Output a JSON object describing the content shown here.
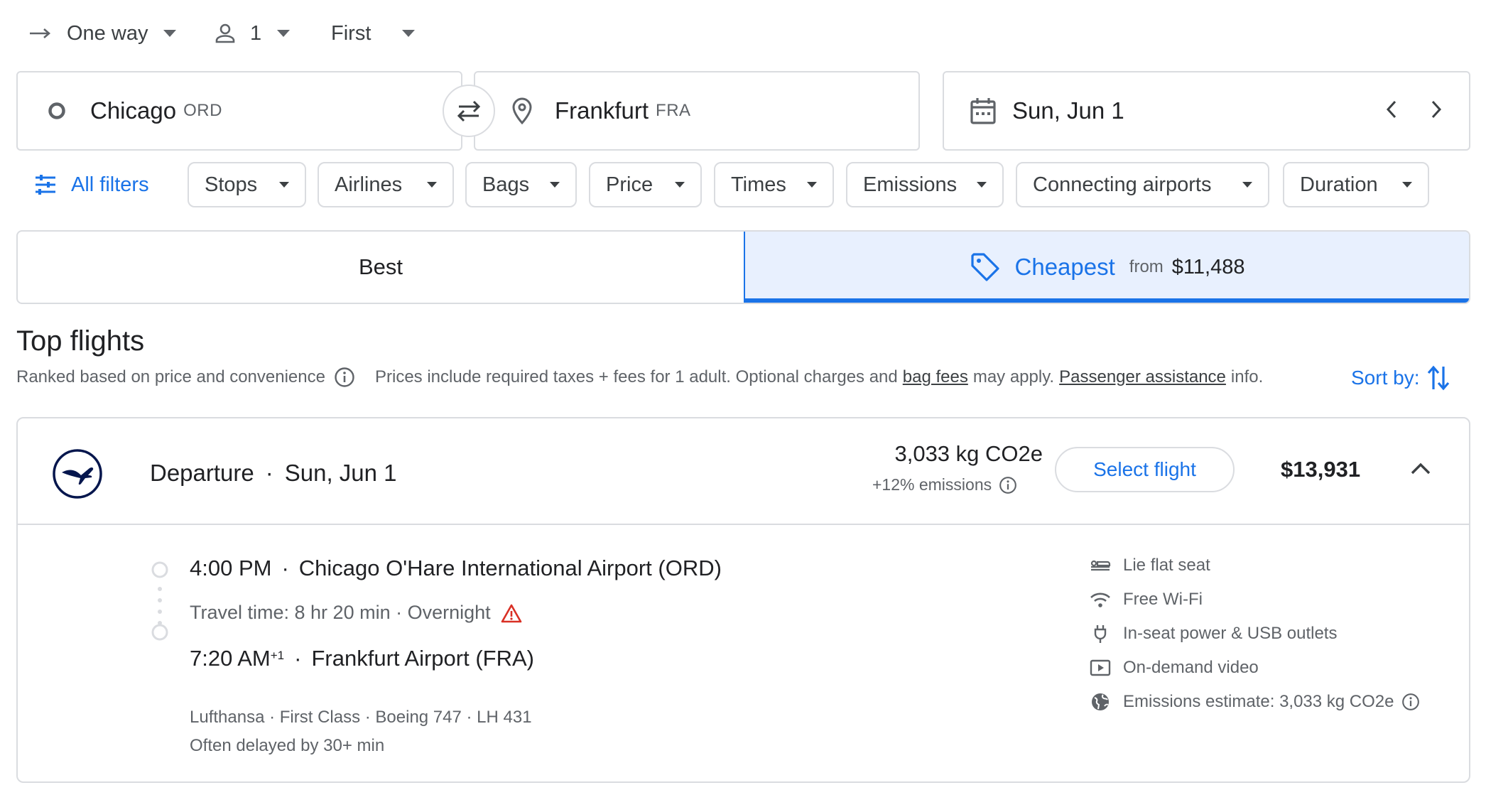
{
  "trip": {
    "type_label": "One way",
    "passengers": "1",
    "cabin": "First"
  },
  "search": {
    "origin_city": "Chicago",
    "origin_code": "ORD",
    "destination_city": "Frankfurt",
    "destination_code": "FRA",
    "date": "Sun, Jun 1"
  },
  "filters": {
    "all_filters_label": "All filters",
    "chips": [
      "Stops",
      "Airlines",
      "Bags",
      "Price",
      "Times",
      "Emissions",
      "Connecting airports",
      "Duration"
    ]
  },
  "tabs": {
    "best_label": "Best",
    "cheapest_label": "Cheapest",
    "cheapest_from": "from",
    "cheapest_price": "$11,488"
  },
  "results": {
    "heading": "Top flights",
    "ranked_text": "Ranked based on price and convenience",
    "prices_text_1": "Prices include required taxes + fees for 1 adult. Optional charges and",
    "bag_fees_link": "bag fees",
    "prices_text_2": "may apply.",
    "passenger_assistance_link": "Passenger assistance",
    "prices_text_3": "info.",
    "sort_label": "Sort by:"
  },
  "flight": {
    "title": "Departure",
    "sep": "·",
    "date": "Sun, Jun 1",
    "emissions": "3,033 kg CO2e",
    "emissions_delta": "+12% emissions",
    "select_label": "Select flight",
    "price": "$13,931",
    "depart_time": "4:00 PM",
    "depart_airport": "Chicago O'Hare International Airport (ORD)",
    "travel_time": "Travel time: 8 hr 20 min · Overnight",
    "arrive_time": "7:20 AM",
    "arrive_plus": "+1",
    "arrive_airport": "Frankfurt Airport (FRA)",
    "details": "Lufthansa · First Class · Boeing 747 · LH 431",
    "delay_note": "Often delayed by 30+ min",
    "amenities": [
      {
        "icon": "lie-flat-seat-icon",
        "label": "Lie flat seat"
      },
      {
        "icon": "wifi-icon",
        "label": "Free Wi-Fi"
      },
      {
        "icon": "power-plug-icon",
        "label": "In-seat power & USB outlets"
      },
      {
        "icon": "video-icon",
        "label": "On-demand video"
      },
      {
        "icon": "globe-icon",
        "label": "Emissions estimate: 3,033 kg CO2e"
      }
    ]
  },
  "colors": {
    "accent": "#1a73e8",
    "border": "#dadce0",
    "selected_tab_bg": "#e8f0fe",
    "warning": "#d93025",
    "airline_navy": "#05164d"
  }
}
